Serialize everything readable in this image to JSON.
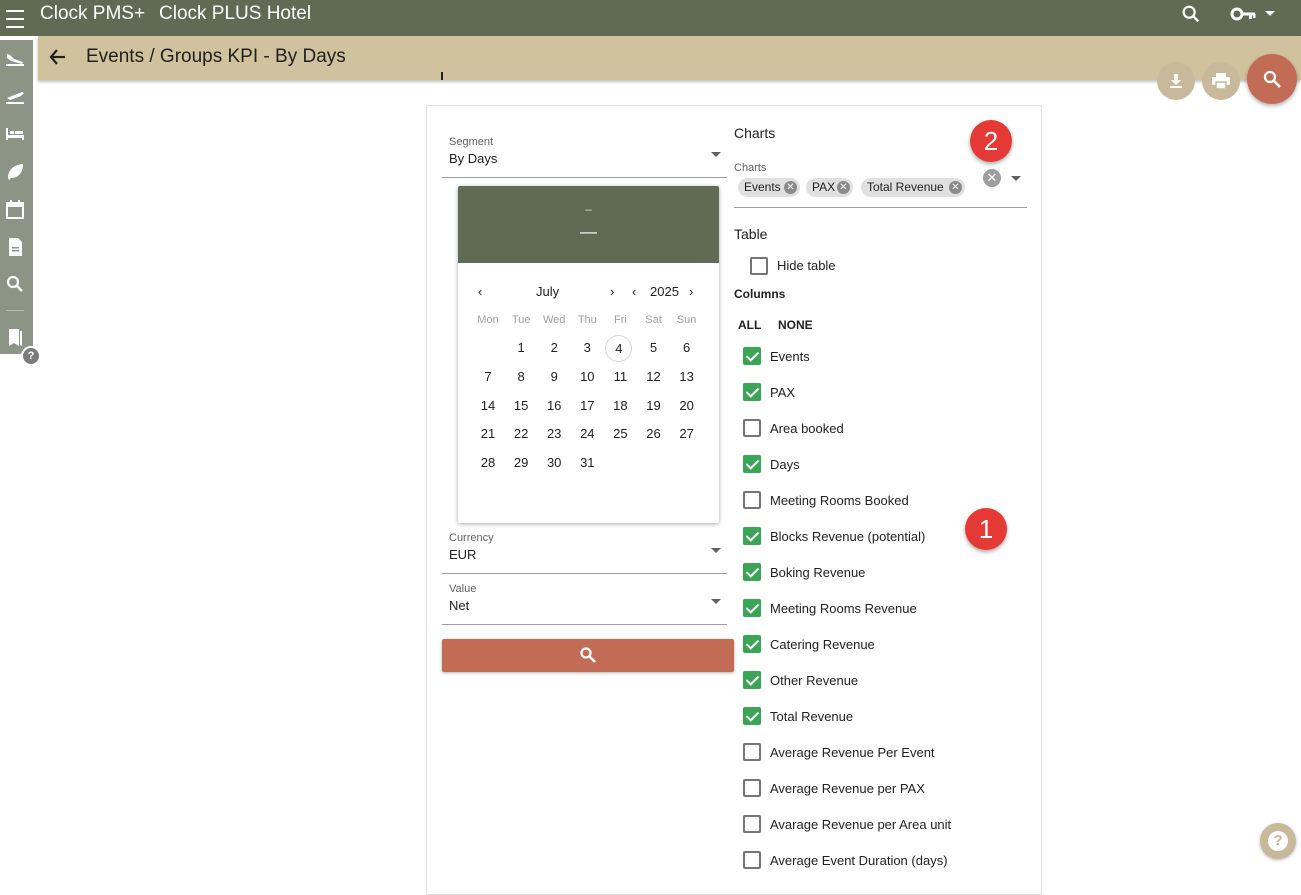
{
  "app": {
    "name": "Clock PMS+",
    "hotel": "Clock PLUS Hotel"
  },
  "page": {
    "title": "Events / Groups KPI - By Days"
  },
  "filters": {
    "segment": {
      "label": "Segment",
      "value": "By Days"
    },
    "currency": {
      "label": "Currency",
      "value": "EUR"
    },
    "value": {
      "label": "Value",
      "value": "Net"
    }
  },
  "calendar": {
    "header_line1": "–",
    "header_line2": "—",
    "month": "July",
    "year": "2025",
    "weekdays": [
      "Mon",
      "Tue",
      "Wed",
      "Thu",
      "Fri",
      "Sat",
      "Sun"
    ],
    "days": [
      "1",
      "2",
      "3",
      "4",
      "5",
      "6",
      "7",
      "8",
      "9",
      "10",
      "11",
      "12",
      "13",
      "14",
      "15",
      "16",
      "17",
      "18",
      "19",
      "20",
      "21",
      "22",
      "23",
      "24",
      "25",
      "26",
      "27",
      "28",
      "29",
      "30",
      "31"
    ],
    "today": "4"
  },
  "charts": {
    "section_title": "Charts",
    "field_label": "Charts",
    "chips": [
      "Events",
      "PAX",
      "Total Revenue"
    ]
  },
  "table": {
    "section_title": "Table",
    "hide_table_label": "Hide table",
    "hide_table_checked": false
  },
  "columns": {
    "title": "Columns",
    "all_label": "ALL",
    "none_label": "NONE",
    "items": [
      {
        "label": "Events",
        "checked": true
      },
      {
        "label": "PAX",
        "checked": true
      },
      {
        "label": "Area booked",
        "checked": false
      },
      {
        "label": "Days",
        "checked": true
      },
      {
        "label": "Meeting Rooms Booked",
        "checked": false
      },
      {
        "label": "Blocks Revenue (potential)",
        "checked": true
      },
      {
        "label": "Boking Revenue",
        "checked": true
      },
      {
        "label": "Meeting Rooms Revenue",
        "checked": true
      },
      {
        "label": "Catering Revenue",
        "checked": true
      },
      {
        "label": "Other Revenue",
        "checked": true
      },
      {
        "label": "Total Revenue",
        "checked": true
      },
      {
        "label": "Average Revenue Per Event",
        "checked": false
      },
      {
        "label": "Average Revenue per PAX",
        "checked": false
      },
      {
        "label": "Avarage Revenue per Area unit",
        "checked": false
      },
      {
        "label": "Average Event Duration (days)",
        "checked": false
      }
    ]
  },
  "annotations": {
    "badge1": "1",
    "badge2": "2"
  },
  "help": {
    "mini": "?",
    "big": "?"
  },
  "icons": {
    "menu": "hamburger-icon",
    "search": "search-icon",
    "key": "key-icon",
    "back": "arrow-back-icon",
    "download": "download-icon",
    "print": "print-icon"
  },
  "colors": {
    "topbar": "#616b53",
    "titlebar": "#d1c29e",
    "accent": "#c26b55",
    "check": "#3aa655"
  }
}
